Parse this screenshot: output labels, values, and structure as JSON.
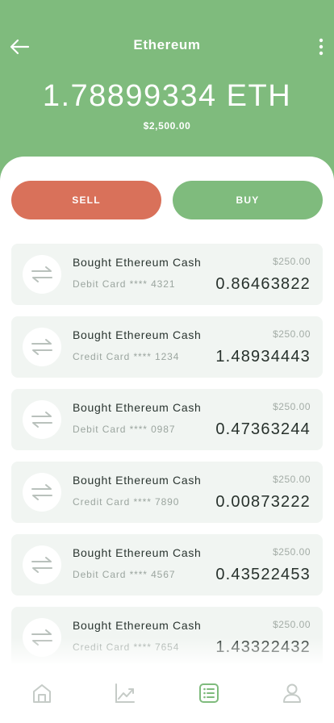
{
  "header": {
    "title": "Ethereum",
    "balance": "1.78899334 ETH",
    "fiat_value": "$2,500.00"
  },
  "actions": {
    "sell_label": "SELL",
    "buy_label": "BUY"
  },
  "transactions": [
    {
      "title": "Bought Ethereum Cash",
      "method": "Debit Card **** 4321",
      "fiat": "$250.00",
      "amount": "0.86463822"
    },
    {
      "title": "Bought Ethereum Cash",
      "method": "Credit Card **** 1234",
      "fiat": "$250.00",
      "amount": "1.48934443"
    },
    {
      "title": "Bought Ethereum Cash",
      "method": "Debit Card **** 0987",
      "fiat": "$250.00",
      "amount": "0.47363244"
    },
    {
      "title": "Bought Ethereum Cash",
      "method": "Credit Card **** 7890",
      "fiat": "$250.00",
      "amount": "0.00873222"
    },
    {
      "title": "Bought Ethereum Cash",
      "method": "Debit Card **** 4567",
      "fiat": "$250.00",
      "amount": "0.43522453"
    },
    {
      "title": "Bought Ethereum Cash",
      "method": "Credit Card **** 7654",
      "fiat": "$250.00",
      "amount": "1.43322432"
    }
  ],
  "tab_bar": {
    "items": [
      {
        "icon": "home-icon",
        "active": false
      },
      {
        "icon": "chart-icon",
        "active": false
      },
      {
        "icon": "list-icon",
        "active": true
      },
      {
        "icon": "user-icon",
        "active": false
      }
    ]
  },
  "colors": {
    "brand_green": "#7fbb7d",
    "sell_red": "#d9715a",
    "card_bg": "#f1f5f2",
    "inactive_icon": "#c5cbc7"
  }
}
